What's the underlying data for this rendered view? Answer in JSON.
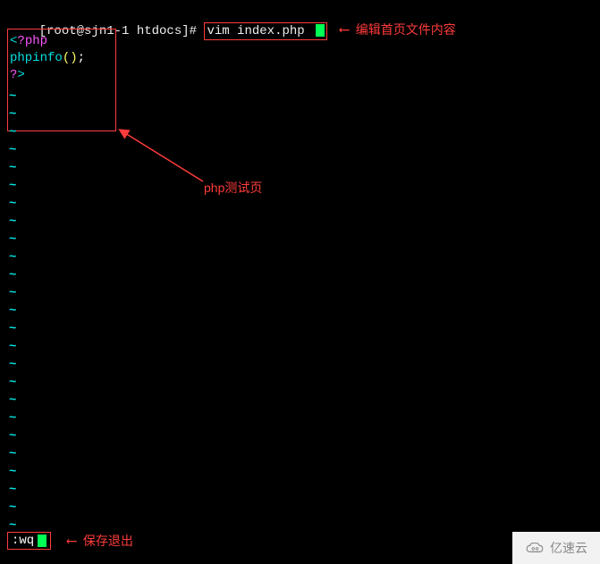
{
  "prompt": {
    "user_host_path": "[root@sjn1-1 htdocs]#",
    "command": "vim index.php "
  },
  "annotations": {
    "edit_hint": "编辑首页文件内容",
    "test_page": "php测试页",
    "save_exit": "保存退出"
  },
  "php_code": {
    "open_bracket": "<",
    "open_q": "?",
    "open_kw": "php",
    "fn_name": "phpinfo",
    "parens": "()",
    "semi": ";",
    "close_q": "?",
    "close_gt": ">"
  },
  "vim_status": {
    "command": ":wq"
  },
  "tilde": "~",
  "watermark": {
    "text": "亿速云"
  }
}
